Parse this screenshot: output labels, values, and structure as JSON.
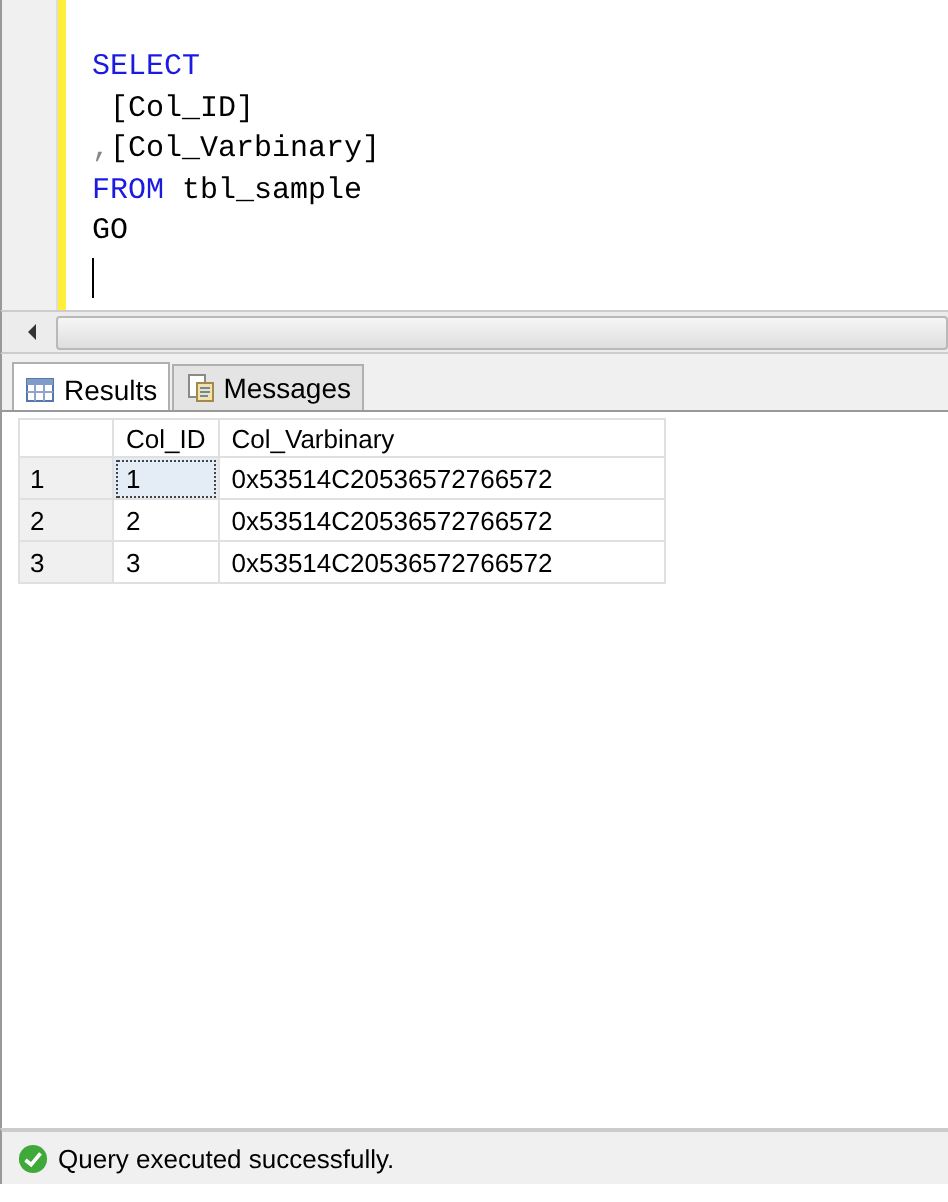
{
  "editor": {
    "lines": [
      {
        "segments": [
          {
            "kind": "keyword",
            "text": "SELECT"
          }
        ]
      },
      {
        "segments": [
          {
            "kind": "plain",
            "text": " [Col_ID]"
          }
        ]
      },
      {
        "segments": [
          {
            "kind": "punct",
            "text": ","
          },
          {
            "kind": "plain",
            "text": "[Col_Varbinary]"
          }
        ]
      },
      {
        "segments": [
          {
            "kind": "keyword",
            "text": "FROM"
          },
          {
            "kind": "plain",
            "text": " tbl_sample"
          }
        ]
      },
      {
        "segments": [
          {
            "kind": "plain",
            "text": "GO"
          }
        ]
      }
    ]
  },
  "tabs": [
    {
      "label": "Results",
      "selected": true,
      "kind": "grid"
    },
    {
      "label": "Messages",
      "selected": false,
      "kind": "messages"
    }
  ],
  "table": {
    "columns": [
      "Col_ID",
      "Col_Varbinary"
    ],
    "rows": [
      {
        "number": "1",
        "cells": [
          {
            "text": "1",
            "selected": true
          },
          {
            "text": "0x53514C20536572766572",
            "selected": false
          }
        ]
      },
      {
        "number": "2",
        "cells": [
          {
            "text": "2",
            "selected": false
          },
          {
            "text": "0x53514C20536572766572",
            "selected": false
          }
        ]
      },
      {
        "number": "3",
        "cells": [
          {
            "text": "3",
            "selected": false
          },
          {
            "text": "0x53514C20536572766572",
            "selected": false
          }
        ]
      }
    ]
  },
  "status_bar": {
    "text": "Query executed successfully."
  }
}
